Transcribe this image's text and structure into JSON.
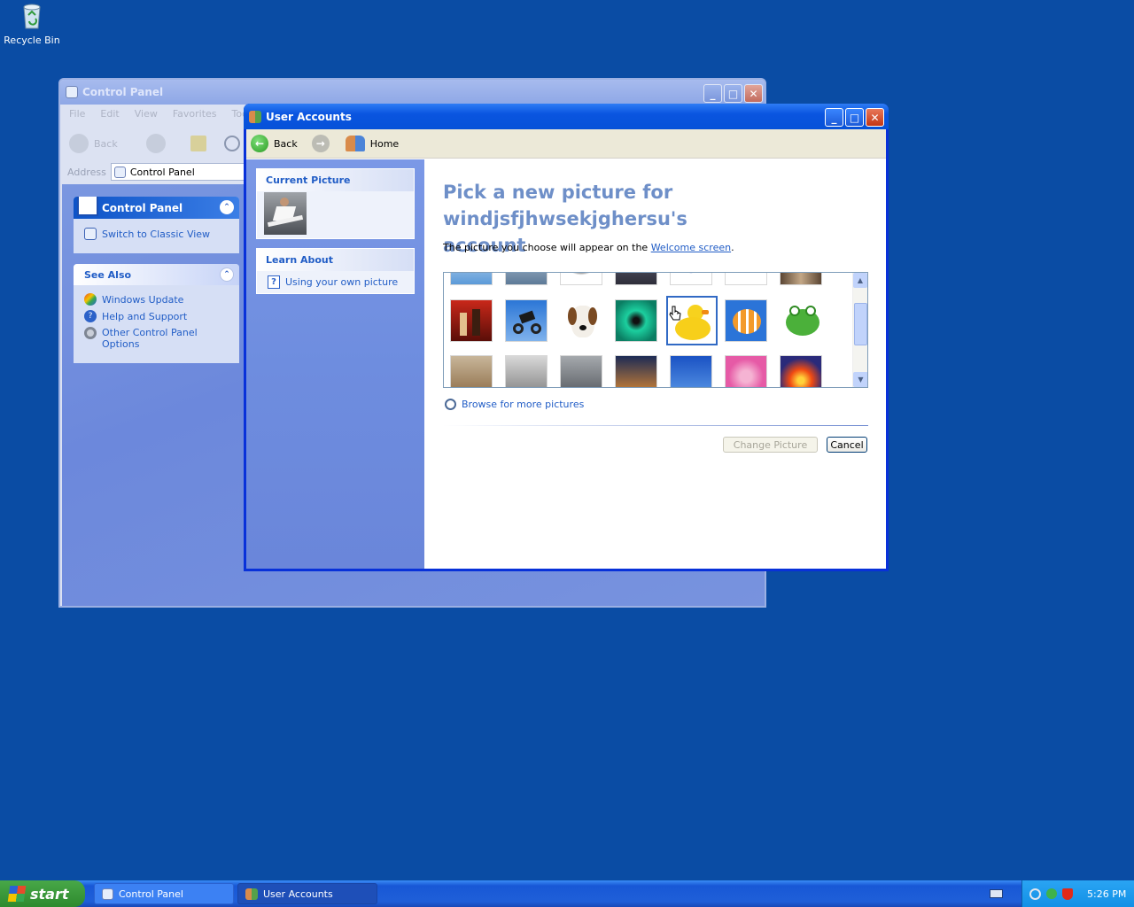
{
  "desktop": {
    "recycle_bin": "Recycle Bin"
  },
  "control_panel": {
    "title": "Control Panel",
    "menu": [
      "File",
      "Edit",
      "View",
      "Favorites",
      "Tools"
    ],
    "toolbar": {
      "back": "Back",
      "search_partial": "S"
    },
    "address_label": "Address",
    "address_value": "Control Panel",
    "box1": {
      "title": "Control Panel",
      "link": "Switch to Classic View"
    },
    "box2": {
      "title": "See Also",
      "links": [
        "Windows Update",
        "Help and Support",
        "Other Control Panel",
        "Options"
      ]
    }
  },
  "user_accounts": {
    "title": "User Accounts",
    "toolbar": {
      "back": "Back",
      "home": "Home"
    },
    "current_picture_label": "Current Picture",
    "learn_about_label": "Learn About",
    "learn_link": "Using your own picture",
    "heading_line1": "Pick a new picture for windjsfjhwsekjghersu's",
    "heading_line2": "account",
    "desc_prefix": "The picture you choose will appear on the ",
    "desc_link": "Welcome screen",
    "desc_suffix": ".",
    "browse": "Browse for more pictures",
    "change_button": "Change Picture",
    "cancel_button": "Cancel"
  },
  "taskbar": {
    "start": "start",
    "tasks": [
      "Control Panel",
      "User Accounts"
    ],
    "clock": "5:26 PM"
  },
  "colors": {
    "desktop": "#0a4ca4",
    "xp_blue": "#0054e3",
    "link": "#215dc6",
    "heading": "#6e8fc8"
  }
}
